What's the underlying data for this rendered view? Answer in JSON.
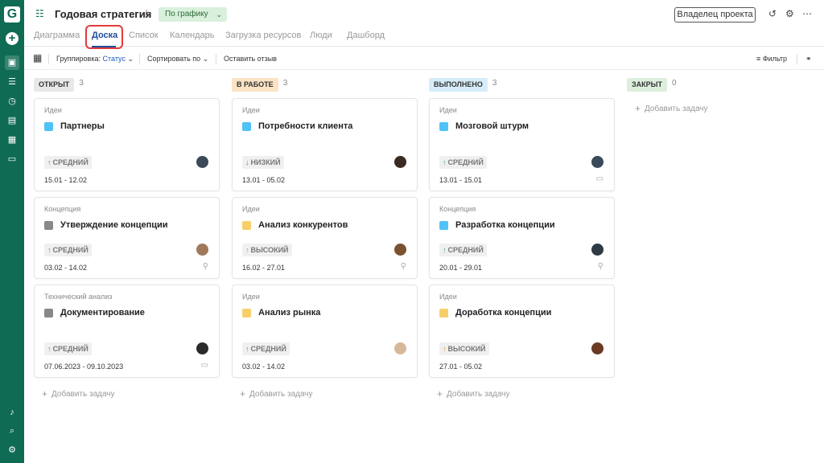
{
  "rail": {
    "logo": "G",
    "items": [
      "folder-icon",
      "list-icon",
      "clock-icon",
      "report-icon",
      "grid-icon",
      "chat-icon"
    ],
    "bottom": [
      "bell-icon",
      "search-icon",
      "settings-icon"
    ]
  },
  "header": {
    "title": "Годовая стратегия",
    "status": "По графику",
    "owner_button": "Владелец проекта"
  },
  "tabs": [
    "Диаграмма",
    "Доска",
    "Список",
    "Календарь",
    "Загрузка ресурсов",
    "Люди",
    "Дашборд"
  ],
  "active_tab": "Доска",
  "toolbar": {
    "grouping_label": "Группировка:",
    "grouping_value": "Статус",
    "sort": "Сортировать по",
    "feedback": "Оставить отзыв",
    "filter": "Фильтр"
  },
  "add_task": "Добавить задачу",
  "columns": [
    {
      "name": "ОТКРЫТ",
      "count": "3",
      "color": "#e8e8e8",
      "cards": [
        {
          "category": "Идеи",
          "title": "Партнеры",
          "square": "#4fc3f7",
          "priority": "СРЕДНИЙ",
          "dir": "↑",
          "dir_color": "#3aa55a",
          "dates": "15.01   -   12.02",
          "avatar": "#3b4a5a",
          "extra": ""
        },
        {
          "category": "Концепция",
          "title": "Утверждение концепции",
          "square": "#888888",
          "priority": "СРЕДНИЙ",
          "dir": "↑",
          "dir_color": "#3aa55a",
          "dates": "03.02   -   14.02",
          "avatar": "#a0785a",
          "extra": "paperclip-icon"
        },
        {
          "category": "Технический анализ",
          "title": "Документирование",
          "square": "#888888",
          "priority": "СРЕДНИЙ",
          "dir": "↑",
          "dir_color": "#3aa55a",
          "dates": "07.06.2023   -   09.10.2023",
          "avatar": "#2a2a2a",
          "extra": "comment-icon"
        }
      ]
    },
    {
      "name": "В РАБОТЕ",
      "count": "3",
      "color": "#fbe3c4",
      "cards": [
        {
          "category": "Идеи",
          "title": "Потребности клиента",
          "square": "#4fc3f7",
          "priority": "НИЗКИЙ",
          "dir": "↓",
          "dir_color": "#777777",
          "dates": "13.01   -   05.02",
          "avatar": "#3a2a22",
          "extra": ""
        },
        {
          "category": "Идеи",
          "title": "Анализ конкурентов",
          "square": "#f7cf6a",
          "priority": "ВЫСОКИЙ",
          "dir": "↑",
          "dir_color": "#f08a24",
          "dates": "16.02   -   27.01",
          "avatar": "#7a5230",
          "extra": "paperclip-icon"
        },
        {
          "category": "Идеи",
          "title": "Анализ рынка",
          "square": "#f7cf6a",
          "priority": "СРЕДНИЙ",
          "dir": "↑",
          "dir_color": "#3aa55a",
          "dates": "03.02   -   14.02",
          "avatar": "#d8b89a",
          "extra": ""
        }
      ]
    },
    {
      "name": "ВЫПОЛНЕНО",
      "count": "3",
      "color": "#d6ecf9",
      "cards": [
        {
          "category": "Идеи",
          "title": "Мозговой штурм",
          "square": "#4fc3f7",
          "priority": "СРЕДНИЙ",
          "dir": "↑",
          "dir_color": "#3aa55a",
          "dates": "13.01   -   15.01",
          "avatar": "#3b4a5a",
          "extra": "comment-icon"
        },
        {
          "category": "Концепция",
          "title": "Разработка концепции",
          "square": "#4fc3f7",
          "priority": "СРЕДНИЙ",
          "dir": "↑",
          "dir_color": "#3aa55a",
          "dates": "20.01   -   29.01",
          "avatar": "#2e3a44",
          "extra": "paperclip-icon"
        },
        {
          "category": "Идеи",
          "title": "Доработка концепции",
          "square": "#f7cf6a",
          "priority": "ВЫСОКИЙ",
          "dir": "↑",
          "dir_color": "#f08a24",
          "dates": "27.01   -   05.02",
          "avatar": "#6a3a24",
          "extra": ""
        }
      ]
    },
    {
      "name": "ЗАКРЫТ",
      "count": "0",
      "color": "#dcefdc",
      "cards": []
    }
  ]
}
